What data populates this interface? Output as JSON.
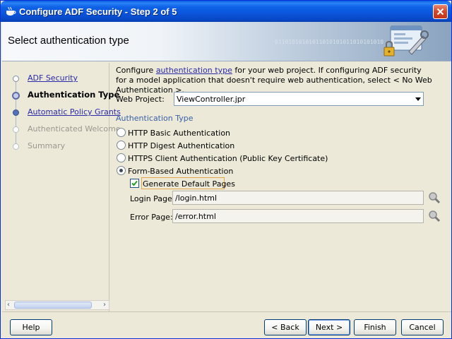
{
  "window": {
    "title": "Configure ADF Security - Step 2 of 5"
  },
  "banner": {
    "title": "Select authentication type",
    "binary_text": "01101010101011010101011010101010"
  },
  "nav": {
    "items": [
      {
        "label": "ADF Security",
        "state": "visited"
      },
      {
        "label": "Authentication Type",
        "state": "current"
      },
      {
        "label": "Automatic Policy Grants",
        "state": "visited"
      },
      {
        "label": "Authenticated Welcome",
        "state": "disabled"
      },
      {
        "label": "Summary",
        "state": "disabled"
      }
    ]
  },
  "main": {
    "intro_prefix": "Configure ",
    "intro_link": "authentication type",
    "intro_suffix": " for your web project. If configuring ADF security for a model application that doesn't require web authentication, select < No Web Authentication >.",
    "web_project_label": "Web Project:",
    "web_project_value": "ViewController.jpr",
    "section_title": "Authentication Type",
    "radios": [
      {
        "label": "HTTP Basic Authentication",
        "checked": false
      },
      {
        "label": "HTTP Digest Authentication",
        "checked": false
      },
      {
        "label": "HTTPS Client Authentication (Public Key Certificate)",
        "checked": false
      },
      {
        "label": "Form-Based Authentication",
        "checked": true
      }
    ],
    "generate_default_pages_label": "Generate Default Pages",
    "generate_default_pages_checked": true,
    "login_page_label": "Login Page:",
    "login_page_value": "/login.html",
    "error_page_label": "Error Page:",
    "error_page_value": "/error.html"
  },
  "buttons": {
    "help": "Help",
    "back": "< Back",
    "next": "Next >",
    "finish": "Finish",
    "cancel": "Cancel"
  },
  "colors": {
    "titlebar": "#0a55dc",
    "link": "#2a2aa8",
    "section_title": "#3960a9"
  }
}
